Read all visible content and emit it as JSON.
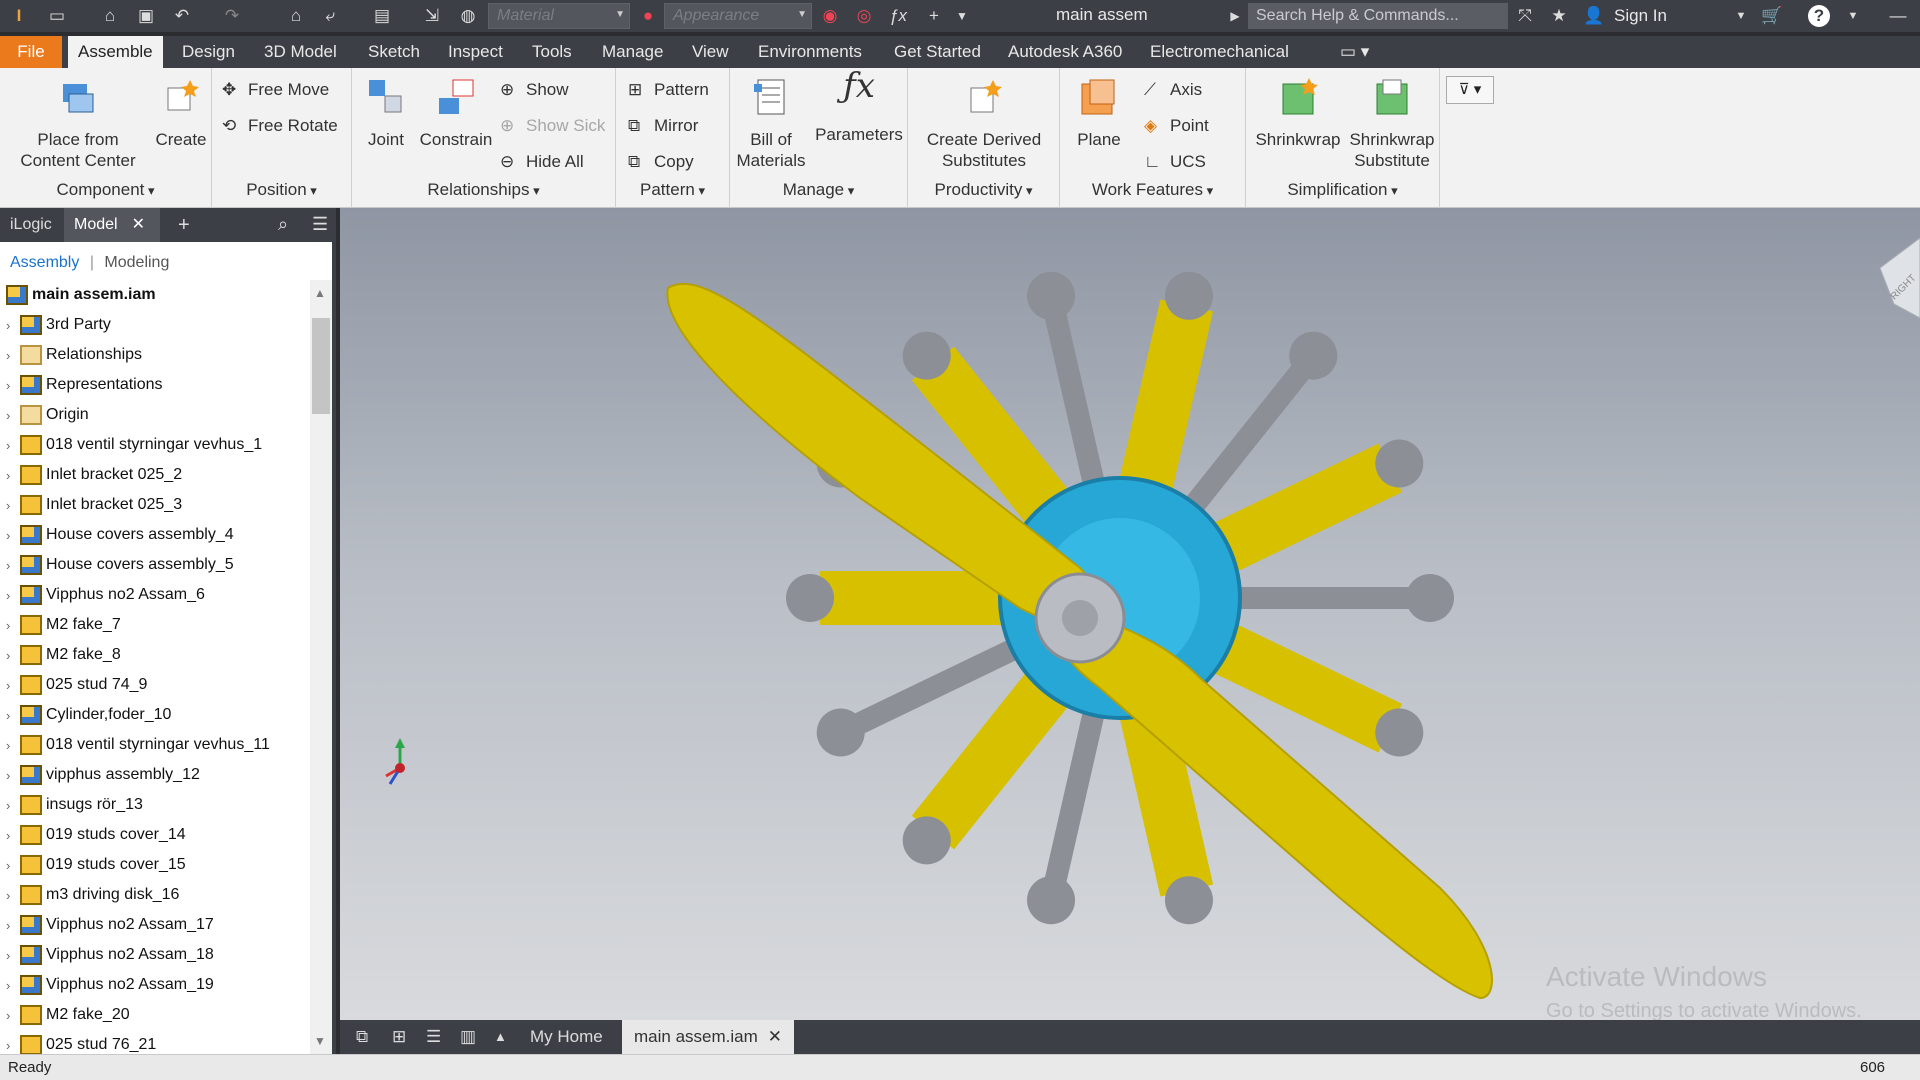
{
  "titlebar": {
    "material_placeholder": "Material",
    "appearance_placeholder": "Appearance",
    "doc_title": "main assem",
    "search_placeholder": "Search Help & Commands...",
    "sign_in": "Sign In"
  },
  "tabs": [
    "File",
    "Assemble",
    "Design",
    "3D Model",
    "Sketch",
    "Inspect",
    "Tools",
    "Manage",
    "View",
    "Environments",
    "Get Started",
    "Autodesk A360",
    "Electromechanical"
  ],
  "ribbon": {
    "component": {
      "label": "Component",
      "place": "Place from\nContent Center",
      "create": "Create"
    },
    "position": {
      "label": "Position",
      "free_move": "Free Move",
      "free_rotate": "Free Rotate"
    },
    "relationships": {
      "label": "Relationships",
      "joint": "Joint",
      "constrain": "Constrain",
      "show": "Show",
      "show_sick": "Show Sick",
      "hide_all": "Hide All"
    },
    "pattern": {
      "label": "Pattern",
      "pattern": "Pattern",
      "mirror": "Mirror",
      "copy": "Copy"
    },
    "manage": {
      "label": "Manage",
      "bom": "Bill of\nMaterials",
      "params": "Parameters"
    },
    "productivity": {
      "label": "Productivity",
      "derived": "Create Derived\nSubstitutes"
    },
    "work": {
      "label": "Work Features",
      "plane": "Plane",
      "axis": "Axis",
      "point": "Point",
      "ucs": "UCS"
    },
    "simplification": {
      "label": "Simplification",
      "shrinkwrap": "Shrinkwrap",
      "shrinkwrap_sub": "Shrinkwrap\nSubstitute"
    }
  },
  "panel": {
    "tab_ilogic": "iLogic",
    "tab_model": "Model",
    "sub_assembly": "Assembly",
    "sub_modeling": "Modeling",
    "root": "main assem.iam",
    "items": [
      {
        "label": "3rd Party",
        "icon": "third-party"
      },
      {
        "label": "Relationships",
        "icon": "folder"
      },
      {
        "label": "Representations",
        "icon": "representations"
      },
      {
        "label": "Origin",
        "icon": "folder"
      },
      {
        "label": "018 ventil styrningar vevhus_1",
        "icon": "part-grounded"
      },
      {
        "label": "Inlet bracket 025_2",
        "icon": "part"
      },
      {
        "label": "Inlet bracket 025_3",
        "icon": "part"
      },
      {
        "label": "House covers assembly_4",
        "icon": "assembly"
      },
      {
        "label": "House covers assembly_5",
        "icon": "assembly"
      },
      {
        "label": "Vipphus no2 Assam_6",
        "icon": "assembly"
      },
      {
        "label": "M2 fake_7",
        "icon": "part"
      },
      {
        "label": "M2 fake_8",
        "icon": "part"
      },
      {
        "label": "025 stud 74_9",
        "icon": "part"
      },
      {
        "label": "Cylinder,foder_10",
        "icon": "assembly"
      },
      {
        "label": "018 ventil styrningar vevhus_11",
        "icon": "part"
      },
      {
        "label": "vipphus assembly_12",
        "icon": "assembly"
      },
      {
        "label": "insugs rör_13",
        "icon": "part"
      },
      {
        "label": "019 studs cover_14",
        "icon": "part"
      },
      {
        "label": "019 studs cover_15",
        "icon": "part"
      },
      {
        "label": "m3 driving disk_16",
        "icon": "part"
      },
      {
        "label": "Vipphus no2 Assam_17",
        "icon": "assembly"
      },
      {
        "label": "Vipphus no2 Assam_18",
        "icon": "assembly"
      },
      {
        "label": "Vipphus no2 Assam_19",
        "icon": "assembly"
      },
      {
        "label": "M2 fake_20",
        "icon": "part"
      },
      {
        "label": "025 stud 76_21",
        "icon": "part"
      }
    ]
  },
  "viewport": {
    "watermark_title": "Activate Windows",
    "watermark_sub": "Go to Settings to activate Windows.",
    "viewcube_face": "RIGHT"
  },
  "doctabs": {
    "home": "My Home",
    "doc": "main assem.iam"
  },
  "status": {
    "left": "Ready",
    "right": "606"
  }
}
